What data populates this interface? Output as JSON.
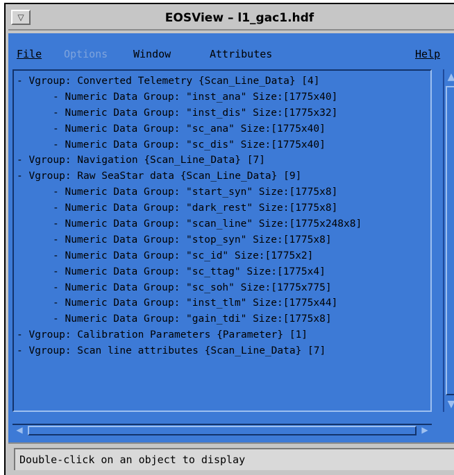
{
  "window": {
    "title": "EOSView – l1_gac1.hdf",
    "menu_button_glyph": "▽"
  },
  "menubar": {
    "items": [
      {
        "label": "File",
        "enabled": true
      },
      {
        "label": "Options",
        "enabled": false
      },
      {
        "label": "Window",
        "enabled": true
      },
      {
        "label": "Attributes",
        "enabled": true
      },
      {
        "label": "Help",
        "enabled": true
      }
    ]
  },
  "tree": {
    "rows": [
      {
        "text": "- Vgroup: Converted Telemetry {Scan_Line_Data} [4]",
        "level": 0
      },
      {
        "text": "- Numeric Data Group: \"inst_ana\" Size:[1775x40]",
        "level": 1
      },
      {
        "text": "- Numeric Data Group: \"inst_dis\" Size:[1775x32]",
        "level": 1
      },
      {
        "text": "- Numeric Data Group: \"sc_ana\" Size:[1775x40]",
        "level": 1
      },
      {
        "text": "- Numeric Data Group: \"sc_dis\" Size:[1775x40]",
        "level": 1
      },
      {
        "text": "- Vgroup: Navigation {Scan_Line_Data} [7]",
        "level": 0
      },
      {
        "text": "- Vgroup: Raw SeaStar data {Scan_Line_Data} [9]",
        "level": 0
      },
      {
        "text": "- Numeric Data Group: \"start_syn\" Size:[1775x8]",
        "level": 1
      },
      {
        "text": "- Numeric Data Group: \"dark_rest\" Size:[1775x8]",
        "level": 1
      },
      {
        "text": "- Numeric Data Group: \"scan_line\" Size:[1775x248x8]",
        "level": 1
      },
      {
        "text": "- Numeric Data Group: \"stop_syn\" Size:[1775x8]",
        "level": 1
      },
      {
        "text": "- Numeric Data Group: \"sc_id\" Size:[1775x2]",
        "level": 1
      },
      {
        "text": "- Numeric Data Group: \"sc_ttag\" Size:[1775x4]",
        "level": 1
      },
      {
        "text": "- Numeric Data Group: \"sc_soh\" Size:[1775x775]",
        "level": 1
      },
      {
        "text": "- Numeric Data Group: \"inst_tlm\" Size:[1775x44]",
        "level": 1
      },
      {
        "text": "- Numeric Data Group: \"gain_tdi\" Size:[1775x8]",
        "level": 1
      },
      {
        "text": "- Vgroup: Calibration Parameters {Parameter} [1]",
        "level": 0
      },
      {
        "text": "- Vgroup: Scan line attributes {Scan_Line_Data} [7]",
        "level": 0
      }
    ]
  },
  "statusbar": {
    "message": "Double-click on an object to display"
  },
  "colors": {
    "accent_blue": "#3d7ad6",
    "chrome_gray": "#c6c6c6"
  }
}
